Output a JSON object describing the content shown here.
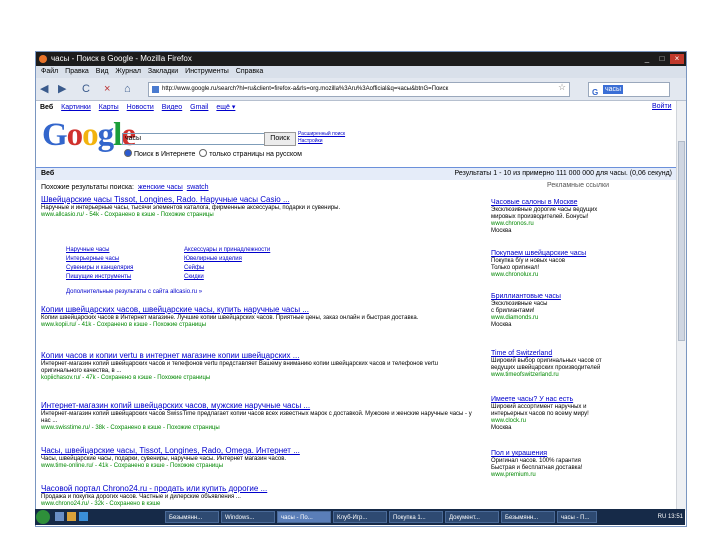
{
  "window": {
    "title": "часы - Поиск в Google - Mozilla Firefox",
    "controls": [
      "_",
      "□",
      "×"
    ]
  },
  "menu": [
    "Файл",
    "Правка",
    "Вид",
    "Журнал",
    "Закладки",
    "Инструменты",
    "Справка"
  ],
  "nav": {
    "back": "◀",
    "forward": "▶",
    "reload": "C",
    "stop": "×",
    "home": "⌂",
    "url": "http://www.google.ru/search?hl=ru&client=firefox-a&rls=org.mozilla%3Aru%3Aofficial&q=часы&btnG=Поиск",
    "search_value": "часы"
  },
  "gbar": {
    "items": [
      "Веб",
      "Картинки",
      "Карты",
      "Новости",
      "Видео",
      "Gmail",
      "ещё ▾"
    ],
    "right": "Войти"
  },
  "search": {
    "query": "часы",
    "button": "Поиск",
    "advanced_link": "Расширенный поиск",
    "settings_link": "Настройки",
    "radio_web": "Поиск в Интернете",
    "radio_ru": "только страницы на русском"
  },
  "results_bar": {
    "left": "Веб",
    "right": "Результаты 1 - 10 из примерно 111 000 000 для часы. (0,06 секунд)"
  },
  "related": {
    "label": "Похожие результаты поиска:",
    "links": [
      "женские часы",
      "swatch"
    ]
  },
  "results": [
    {
      "title": "Швейцарские часы Tissot, Longines, Rado. Наручные часы Casio ...",
      "snippet": "Наручные и интерьерные часы, тысячи элементов каталога, фирменные аксессуары, подарки и сувениры.",
      "url": "www.allcasio.ru/ - 54k - Сохранено в кэше - Похожие страницы"
    },
    {
      "title": "Копии швейцарских часов, швейцарские часы, купить наручные часы ...",
      "snippet": "Копии швейцарских часов в Интернет магазине. Лучшие копии швейцарских часов. Приятные цены, заказ онлайн и быстрая доставка.",
      "url": "www.kopii.ru/ - 41k - Сохранено в кэше - Похожие страницы"
    },
    {
      "title": "Копии часов и копии vertu в интернет магазине копии швейцарских ...",
      "snippet": "Интернет-магазин копий швейцарских часов и телефонов vertu представляет Вашему вниманию копии швейцарских часов и телефонов vertu оригинального качества, в ...",
      "url": "kopiichasov.ru/ - 47k - Сохранено в кэше - Похожие страницы"
    },
    {
      "title": "Интернет-магазин копий швейцарских часов, мужские наручные часы ...",
      "snippet": "Интернет-магазин копий швейцарских часов SwissTime предлагает копии часов всех известных марок с доставкой. Мужские и женские наручные часы - у нас ...",
      "url": "www.swisstime.ru/ - 38k - Сохранено в кэше - Похожие страницы"
    },
    {
      "title": "Часы, швейцарские часы, Tissot, Longines, Rado, Omega. Интернет ...",
      "snippet": "Часы, швейцарские часы, подарки, сувениры, наручные часы. Интернет магазин часов.",
      "url": "www.time-online.ru/ - 41k - Сохранено в кэше - Похожие страницы"
    },
    {
      "title": "Часовой портал Chrono24.ru - продать или купить дорогие ...",
      "snippet": "Продажа и покупка дорогих часов. Частные и дилерские объявления ...",
      "url": "www.chrono24.ru/ - 32k - Сохранено в кэше"
    }
  ],
  "sitelinks": [
    "Наручные часы",
    "Интерьерные часы",
    "Сувениры и канцелярия",
    "Пишущие инструменты",
    "Аксессуары и принадлежности",
    "Ювелирные изделия",
    "Сейфы",
    "Скидки"
  ],
  "more_results": "Дополнительные результаты с сайта allcasio.ru »",
  "ads_header": "Рекламные ссылки",
  "ads": [
    {
      "title": "Часовые салоны в Москве",
      "lines": [
        "Эксклюзивные дорогие часы ведущих",
        "мировых производителей. Бонусы!"
      ],
      "url": "www.chronos.ru",
      "loc": "Москва"
    },
    {
      "title": "Покупаем швейцарские часы",
      "lines": [
        "Покупка б/у и новых часов",
        "Только оригинал!"
      ],
      "url": "www.chronolux.ru",
      "loc": ""
    },
    {
      "title": "Бриллиантовые часы",
      "lines": [
        "Эксклюзивные часы",
        "с брилиантами!"
      ],
      "url": "www.diamonds.ru",
      "loc": "Москва"
    },
    {
      "title": "Time of Switzerland",
      "lines": [
        "Широкий выбор оригинальных часов от",
        "ведущих швейцарских производителей"
      ],
      "url": "www.timeofswitzerland.ru",
      "loc": ""
    },
    {
      "title": "Имеете часы? У нас есть",
      "lines": [
        "Широкий ассортимент наручных и",
        "интерьерных часов по всему миру!"
      ],
      "url": "www.clock.ru",
      "loc": "Москва"
    },
    {
      "title": "Пол и украшения",
      "lines": [
        "Оригинал часов. 100% гарантия",
        "Быстрая и бесплатная доставка!"
      ],
      "url": "www.premium.ru",
      "loc": ""
    }
  ],
  "taskbar": {
    "buttons": [
      "Безымянн...",
      "Windows...",
      "часы - По...",
      "Клуб-Игр...",
      "Покупка 1...",
      "Документ...",
      "Безымянн...",
      "часы - П..."
    ],
    "tray": "RU  13:51"
  }
}
